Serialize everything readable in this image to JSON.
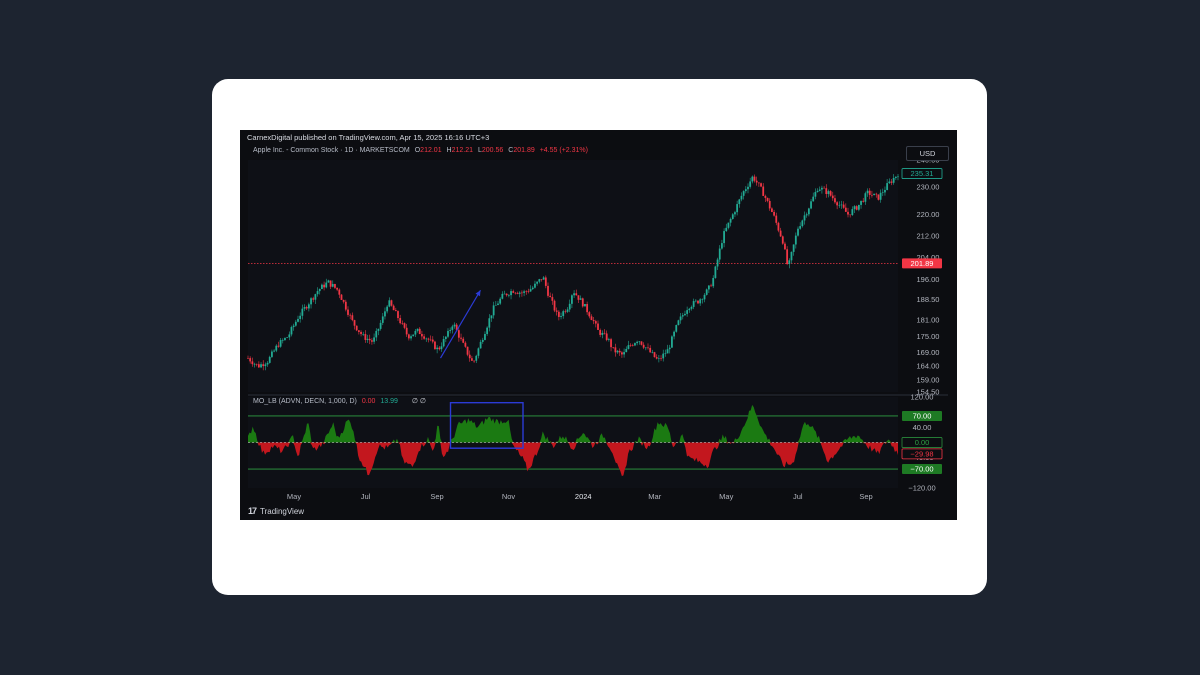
{
  "header": {
    "published": "CarnexDigital published on TradingView.com, Apr 15, 2025 16:16 UTC+3"
  },
  "legend": {
    "symbol": "Apple Inc. - Common Stock · 1D · MARKETSCOM",
    "o_key": "O",
    "o": "212.01",
    "h_key": "H",
    "h": "212.21",
    "l_key": "L",
    "l": "200.56",
    "c_key": "C",
    "c": "201.89",
    "change": "+4.55 (+2.31%)"
  },
  "currency": "USD",
  "indicator": {
    "name": "MO_LB (ADVN, DECN, 1,000, D)",
    "value1": "0.00",
    "value2": "13.99",
    "extra": "∅  ∅"
  },
  "footer": {
    "logo_mark": "17",
    "brand": "TradingView"
  },
  "colors": {
    "background": "#0c0d11",
    "up": "#22ab94",
    "down": "#f23645",
    "osc_positive": "#1b7a12",
    "osc_negative": "#c3171e",
    "level_line": "#2ea043",
    "annotation": "#2b3bd6"
  },
  "chart_data": [
    {
      "type": "candlestick",
      "title": "Apple Inc. - Common Stock · 1D · MARKETSCOM",
      "y_ticks": [
        "240.00",
        "230.00",
        "220.00",
        "212.00",
        "204.00",
        "196.00",
        "188.50",
        "181.00",
        "175.00",
        "169.00",
        "164.00",
        "159.00",
        "154.50"
      ],
      "ylim": [
        154.5,
        240
      ],
      "x_ticks": [
        "May",
        "Jul",
        "Sep",
        "Nov",
        "2024",
        "Mar",
        "May",
        "Jul",
        "Sep"
      ],
      "x_tick_pos": [
        0.04,
        0.15,
        0.26,
        0.37,
        0.485,
        0.595,
        0.705,
        0.815,
        0.92
      ],
      "last_price_label": "235.31",
      "current_price_label": "201.89",
      "current_price": 201.89,
      "series_points": [
        [
          0,
          167
        ],
        [
          0.02,
          164
        ],
        [
          0.04,
          166
        ],
        [
          0.06,
          172
        ],
        [
          0.08,
          175
        ],
        [
          0.1,
          182
        ],
        [
          0.12,
          187
        ],
        [
          0.14,
          192
        ],
        [
          0.16,
          195
        ],
        [
          0.18,
          192
        ],
        [
          0.19,
          188
        ],
        [
          0.21,
          180
        ],
        [
          0.23,
          175
        ],
        [
          0.25,
          173
        ],
        [
          0.27,
          182
        ],
        [
          0.28,
          188
        ],
        [
          0.3,
          182
        ],
        [
          0.32,
          175
        ],
        [
          0.34,
          177
        ],
        [
          0.36,
          174
        ],
        [
          0.38,
          170
        ],
        [
          0.4,
          176
        ],
        [
          0.41,
          180
        ],
        [
          0.43,
          172
        ],
        [
          0.45,
          165
        ],
        [
          0.47,
          175
        ],
        [
          0.49,
          185
        ],
        [
          0.51,
          190
        ],
        [
          0.53,
          192
        ],
        [
          0.55,
          191
        ],
        [
          0.57,
          193
        ],
        [
          0.59,
          197
        ],
        [
          0.6,
          191
        ],
        [
          0.62,
          182
        ],
        [
          0.64,
          186
        ],
        [
          0.65,
          192
        ],
        [
          0.67,
          187
        ],
        [
          0.69,
          181
        ],
        [
          0.7,
          177
        ],
        [
          0.72,
          174
        ],
        [
          0.73,
          170
        ],
        [
          0.75,
          168
        ],
        [
          0.76,
          171
        ],
        [
          0.78,
          174
        ],
        [
          0.8,
          170
        ],
        [
          0.82,
          166
        ],
        [
          0.84,
          170
        ],
        [
          0.86,
          180
        ],
        [
          0.88,
          186
        ],
        [
          0.9,
          188
        ],
        [
          0.92,
          192
        ],
        [
          0.93,
          196
        ],
        [
          0.95,
          212
        ],
        [
          0.97,
          220
        ],
        [
          0.99,
          228
        ],
        [
          1.01,
          234
        ],
        [
          1.03,
          228
        ],
        [
          1.05,
          220
        ],
        [
          1.07,
          210
        ],
        [
          1.08,
          200
        ],
        [
          1.1,
          215
        ],
        [
          1.12,
          222
        ],
        [
          1.14,
          230
        ],
        [
          1.16,
          228
        ],
        [
          1.18,
          224
        ],
        [
          1.2,
          220
        ],
        [
          1.22,
          223
        ],
        [
          1.24,
          228
        ],
        [
          1.26,
          226
        ],
        [
          1.28,
          231
        ],
        [
          1.3,
          235
        ]
      ],
      "annotation": "arrow from 0.385,167 to 0.465,192"
    },
    {
      "type": "area",
      "title": "MO_LB (ADVN, DECN, 1,000, D)",
      "y_ticks": [
        "120.00",
        "40.00",
        "−40.00",
        "−120.00"
      ],
      "ylim": [
        -120,
        120
      ],
      "levels": [
        70,
        0,
        -70
      ],
      "level_labels": [
        "70.00",
        "0.00",
        "−70.00"
      ],
      "current_value_label": "−29.98",
      "current_value": -29.98,
      "series_points": [
        [
          0,
          10
        ],
        [
          0.01,
          45
        ],
        [
          0.02,
          5
        ],
        [
          0.03,
          -30
        ],
        [
          0.05,
          -10
        ],
        [
          0.07,
          -25
        ],
        [
          0.09,
          15
        ],
        [
          0.1,
          -40
        ],
        [
          0.12,
          55
        ],
        [
          0.13,
          -20
        ],
        [
          0.15,
          -5
        ],
        [
          0.17,
          50
        ],
        [
          0.18,
          10
        ],
        [
          0.2,
          60
        ],
        [
          0.21,
          40
        ],
        [
          0.22,
          -30
        ],
        [
          0.24,
          -85
        ],
        [
          0.25,
          -55
        ],
        [
          0.26,
          -10
        ],
        [
          0.28,
          -15
        ],
        [
          0.3,
          10
        ],
        [
          0.31,
          -50
        ],
        [
          0.33,
          -65
        ],
        [
          0.34,
          -20
        ],
        [
          0.36,
          10
        ],
        [
          0.37,
          -25
        ],
        [
          0.38,
          50
        ],
        [
          0.39,
          -40
        ],
        [
          0.4,
          -20
        ],
        [
          0.42,
          45
        ],
        [
          0.44,
          60
        ],
        [
          0.46,
          40
        ],
        [
          0.48,
          65
        ],
        [
          0.5,
          55
        ],
        [
          0.52,
          60
        ],
        [
          0.53,
          -10
        ],
        [
          0.55,
          -45
        ],
        [
          0.56,
          -75
        ],
        [
          0.58,
          -20
        ],
        [
          0.59,
          25
        ],
        [
          0.61,
          -10
        ],
        [
          0.63,
          20
        ],
        [
          0.65,
          -15
        ],
        [
          0.67,
          30
        ],
        [
          0.69,
          -10
        ],
        [
          0.71,
          20
        ],
        [
          0.73,
          -25
        ],
        [
          0.74,
          -70
        ],
        [
          0.75,
          -100
        ],
        [
          0.76,
          -30
        ],
        [
          0.78,
          10
        ],
        [
          0.8,
          -15
        ],
        [
          0.82,
          55
        ],
        [
          0.84,
          40
        ],
        [
          0.85,
          -10
        ],
        [
          0.87,
          20
        ],
        [
          0.88,
          -40
        ],
        [
          0.9,
          -50
        ],
        [
          0.92,
          -60
        ],
        [
          0.93,
          -25
        ],
        [
          0.95,
          15
        ],
        [
          0.97,
          -5
        ],
        [
          0.99,
          40
        ],
        [
          1.01,
          100
        ],
        [
          1.03,
          30
        ],
        [
          1.05,
          -10
        ],
        [
          1.07,
          -60
        ],
        [
          1.09,
          -55
        ],
        [
          1.11,
          45
        ],
        [
          1.12,
          55
        ],
        [
          1.14,
          15
        ],
        [
          1.16,
          -50
        ],
        [
          1.18,
          -20
        ],
        [
          1.2,
          10
        ],
        [
          1.22,
          20
        ],
        [
          1.24,
          -10
        ],
        [
          1.26,
          -30
        ],
        [
          1.28,
          10
        ],
        [
          1.3,
          -30
        ]
      ],
      "highlight_box": "around positive region Nov–Jan"
    }
  ]
}
